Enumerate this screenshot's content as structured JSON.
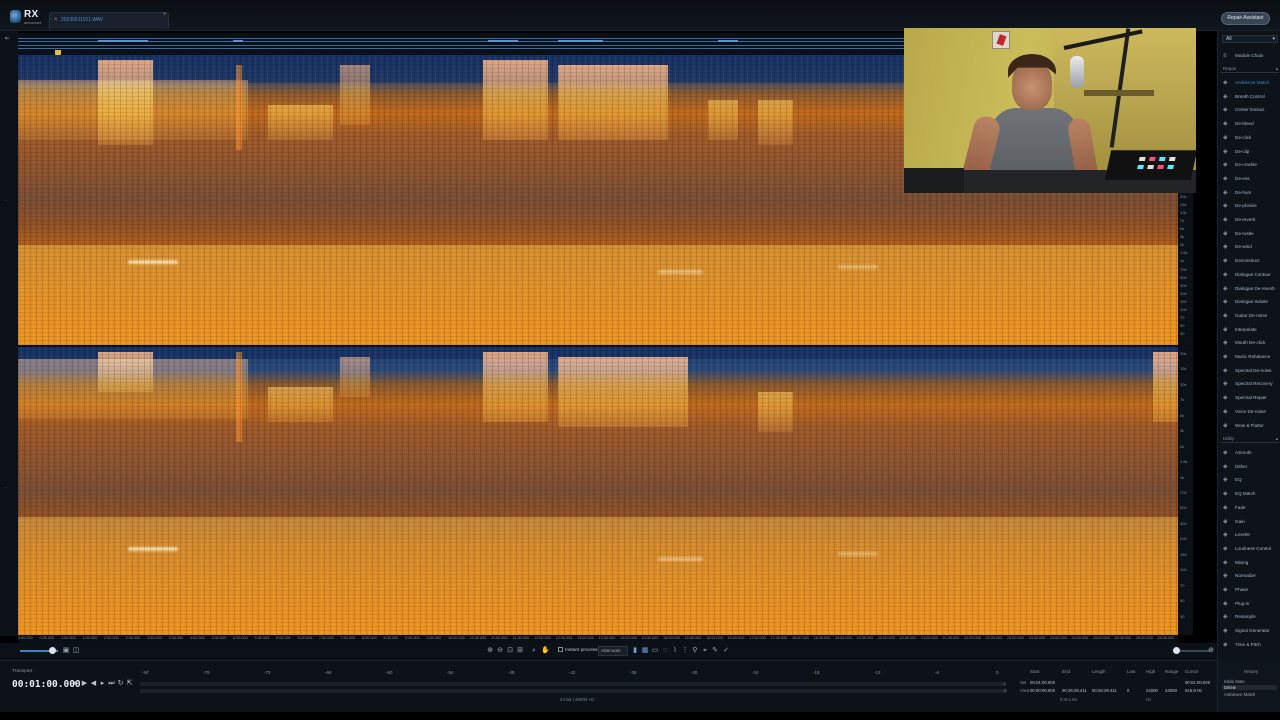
{
  "app": {
    "logo_text": "RX",
    "logo_sub": "advanced"
  },
  "tabs": {
    "file_name": "20230611101.WAV",
    "close_glyph": "×",
    "add_glyph": "+"
  },
  "header": {
    "repair_assistant": "Repair Assistant"
  },
  "modules": {
    "filter_value": "All",
    "chain_label": "Module Chain",
    "repair_header": "Repair",
    "utility_header": "Utility",
    "repair": [
      {
        "label": "Ambience Match",
        "icon": "ambience-icon"
      },
      {
        "label": "Breath Control",
        "icon": "breath-icon"
      },
      {
        "label": "Center Extract",
        "icon": "center-extract-icon"
      },
      {
        "label": "De-bleed",
        "icon": "de-bleed-icon"
      },
      {
        "label": "De-click",
        "icon": "de-click-icon"
      },
      {
        "label": "De-clip",
        "icon": "de-clip-icon"
      },
      {
        "label": "De-crackle",
        "icon": "de-crackle-icon"
      },
      {
        "label": "De-ess",
        "icon": "de-ess-icon"
      },
      {
        "label": "De-hum",
        "icon": "de-hum-icon"
      },
      {
        "label": "De-plosive",
        "icon": "de-plosive-icon"
      },
      {
        "label": "De-reverb",
        "icon": "de-reverb-icon"
      },
      {
        "label": "De-rustle",
        "icon": "de-rustle-icon"
      },
      {
        "label": "De-wind",
        "icon": "de-wind-icon"
      },
      {
        "label": "Deconstruct",
        "icon": "deconstruct-icon"
      },
      {
        "label": "Dialogue Contour",
        "icon": "dialogue-contour-icon"
      },
      {
        "label": "Dialogue De-reverb",
        "icon": "dialogue-de-reverb-icon"
      },
      {
        "label": "Dialogue Isolate",
        "icon": "dialogue-isolate-icon"
      },
      {
        "label": "Guitar De-noise",
        "icon": "guitar-de-noise-icon"
      },
      {
        "label": "Interpolate",
        "icon": "interpolate-icon"
      },
      {
        "label": "Mouth De-click",
        "icon": "mouth-de-click-icon"
      },
      {
        "label": "Music Rebalance",
        "icon": "music-rebalance-icon"
      },
      {
        "label": "Spectral De-noise",
        "icon": "spectral-de-noise-icon"
      },
      {
        "label": "Spectral Recovery",
        "icon": "spectral-recovery-icon"
      },
      {
        "label": "Spectral Repair",
        "icon": "spectral-repair-icon"
      },
      {
        "label": "Voice De-noise",
        "icon": "voice-de-noise-icon"
      },
      {
        "label": "Wow & Flutter",
        "icon": "wow-flutter-icon"
      }
    ],
    "utility": [
      {
        "label": "Azimuth",
        "icon": "azimuth-icon"
      },
      {
        "label": "Dither",
        "icon": "dither-icon"
      },
      {
        "label": "EQ",
        "icon": "eq-icon"
      },
      {
        "label": "EQ Match",
        "icon": "eq-match-icon"
      },
      {
        "label": "Fade",
        "icon": "fade-icon"
      },
      {
        "label": "Gain",
        "icon": "gain-icon"
      },
      {
        "label": "Leveler",
        "icon": "leveler-icon"
      },
      {
        "label": "Loudness Control",
        "icon": "loudness-icon"
      },
      {
        "label": "Mixing",
        "icon": "mixing-icon"
      },
      {
        "label": "Normalize",
        "icon": "normalize-icon"
      },
      {
        "label": "Phase",
        "icon": "phase-icon"
      },
      {
        "label": "Plug-in",
        "icon": "plug-in-icon"
      },
      {
        "label": "Resample",
        "icon": "resample-icon"
      },
      {
        "label": "Signal Generator",
        "icon": "signal-generator-icon"
      },
      {
        "label": "Time & Pitch",
        "icon": "time-pitch-icon"
      }
    ]
  },
  "ruler": [
    "0:00.000",
    "0:30.000",
    "1:00.000",
    "1:30.000",
    "2:00.000",
    "2:30.000",
    "3:00.000",
    "3:30.000",
    "4:00.000",
    "4:30.000",
    "5:00.000",
    "5:30.000",
    "6:00.000",
    "6:30.000",
    "7:00.000",
    "7:30.000",
    "8:00.000",
    "8:30.000",
    "9:00.000",
    "9:30.000",
    "10:00.000",
    "10:30.000",
    "11:00.000",
    "11:30.000",
    "12:00.000",
    "12:30.000",
    "13:00.000",
    "13:30.000",
    "14:00.000",
    "14:30.000",
    "15:00.000",
    "15:30.000",
    "16:00.000",
    "16:30.000",
    "17:00.000",
    "17:30.000",
    "18:00.000",
    "18:30.000",
    "19:00.000",
    "19:30.000",
    "20:00.000",
    "20:30.000",
    "21:00.000",
    "21:30.000",
    "22:00.000",
    "22:30.000",
    "23:00.000",
    "23:30.000",
    "24:00.000",
    "24:30.000",
    "25:00.000",
    "25:30.000",
    "26:00.000",
    "26:30.000"
  ],
  "freq_scale": [
    "20k",
    "15k",
    "10k",
    "7k",
    "5k",
    "3k",
    "2k",
    "1.5k",
    "1k",
    "700",
    "500",
    "300",
    "200",
    "150",
    "100",
    "70",
    "50",
    "30"
  ],
  "toolbar": {
    "instant_process": "Instant process",
    "mode": "Attenuate"
  },
  "transport": {
    "label": "Transport",
    "timecode": "00:01:00.000",
    "meter_ticks": [
      "-Inf",
      "-78",
      "-72",
      "-66",
      "-60",
      "-54",
      "-48",
      "-42",
      "-36",
      "-30",
      "-24",
      "-18",
      "-12",
      "-6",
      "0"
    ],
    "format": "24-bit | 48000 Hz"
  },
  "selection": {
    "headers": [
      "Start",
      "End",
      "Length",
      "Low",
      "High",
      "Range",
      "Cursor"
    ],
    "sel_label": "Sel",
    "view_label": "View",
    "sel_row": [
      "00:01:00.000",
      "",
      "",
      "",
      "",
      "",
      ""
    ],
    "view_row": [
      "00:00:00.000",
      "00:26:29.411",
      "00:26:29.411",
      "0",
      "24000",
      "24000"
    ],
    "cursor": "00:01:00.000",
    "cursor_hz": "615.8 Hz",
    "time_format": "h:m:s.ms",
    "hz_label": "Hz"
  },
  "history": {
    "title": "History",
    "items": [
      "Initial State",
      "Delete",
      "Ambience Match"
    ]
  },
  "colors": {
    "accent": "#3f7fc4",
    "spectro_hot": "#e88a1e",
    "spectro_cold": "#1b3f78"
  }
}
